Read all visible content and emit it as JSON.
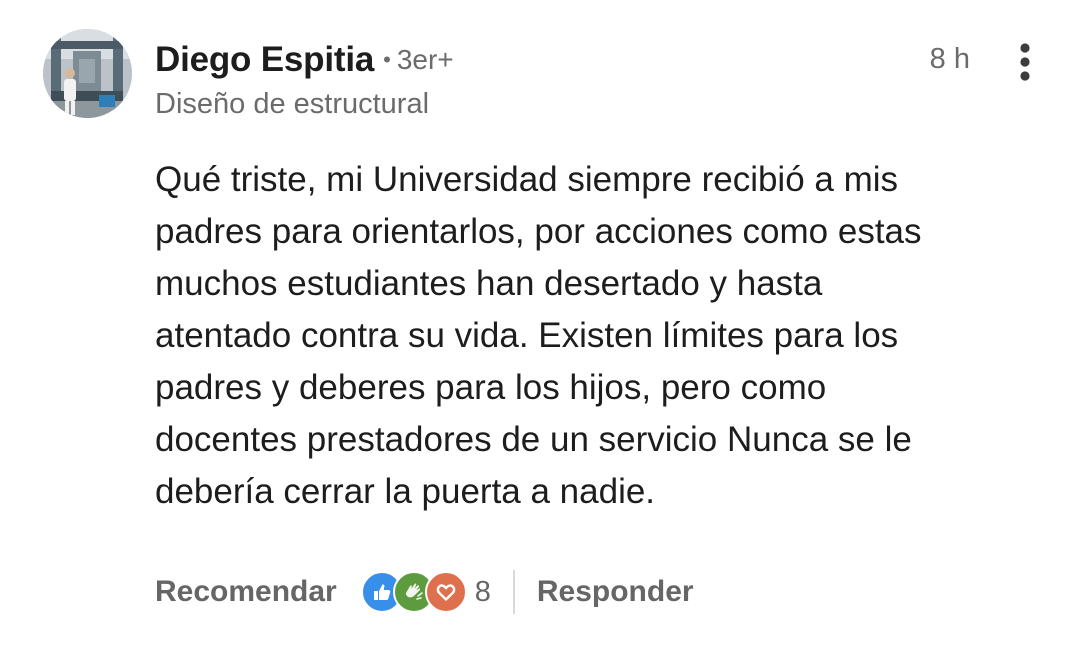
{
  "comment": {
    "author": {
      "name": "Diego Espitia",
      "connection_degree": "3er+",
      "headline": "Diseño de estructural"
    },
    "timestamp": "8 h",
    "body_lines": [
      "Qué triste, mi Universidad siempre recibió a mis",
      "padres para orientarlos, por acciones como estas",
      "muchos estudiantes han desertado y hasta",
      "atentado contra su vida. Existen límites para los",
      "padres y deberes para los hijos, pero como",
      "docentes prestadores de un servicio Nunca se le",
      "debería cerrar la puerta a nadie."
    ],
    "actions": {
      "like_label": "Recomendar",
      "reply_label": "Responder",
      "reaction_count": "8",
      "reaction_icons": [
        "like-icon",
        "celebrate-icon",
        "love-icon"
      ]
    }
  },
  "colors": {
    "text_primary": "#1d1d1d",
    "text_secondary": "#6b6b6b",
    "like_blue": "#378fe9",
    "celebrate_green": "#5d9c3e",
    "love_orange": "#df704d"
  }
}
